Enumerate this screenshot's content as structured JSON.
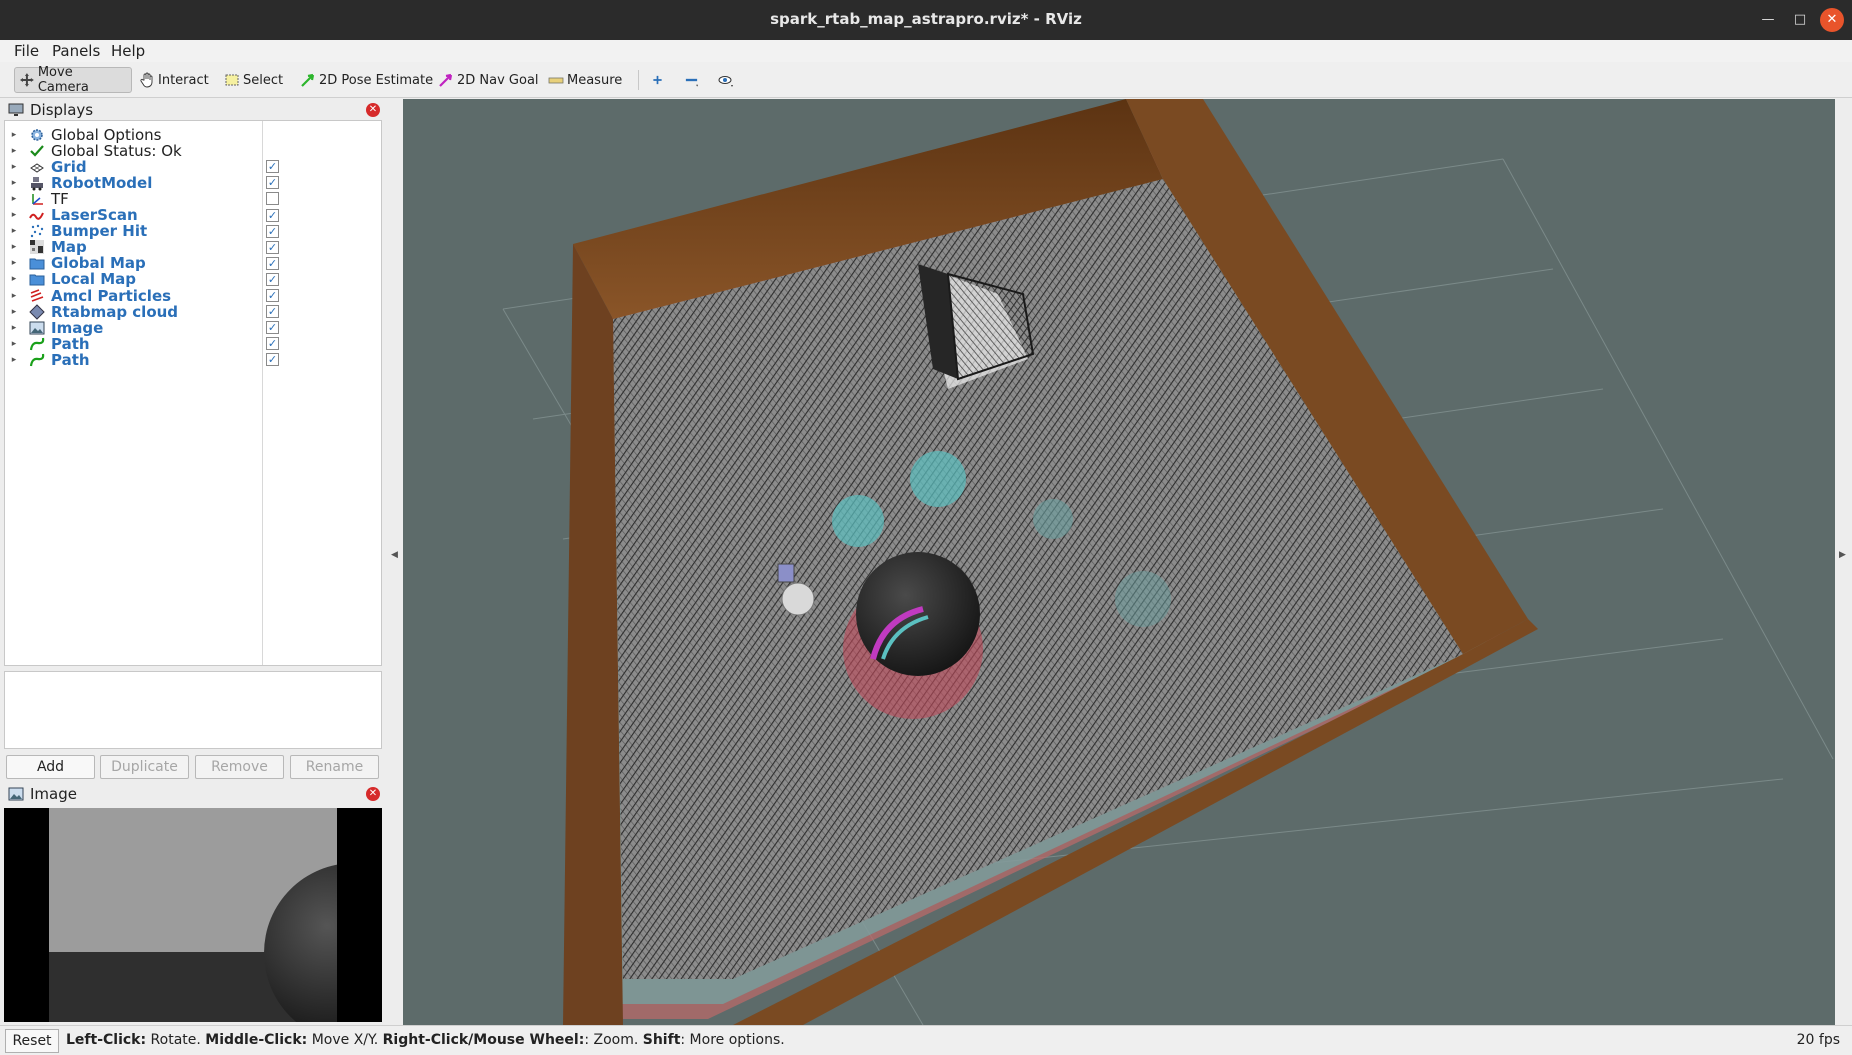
{
  "window": {
    "title": "spark_rtab_map_astrapro.rviz* - RViz"
  },
  "menu": {
    "file": "File",
    "panels": "Panels",
    "help": "Help"
  },
  "toolbar": {
    "move_camera": "Move Camera",
    "interact": "Interact",
    "select": "Select",
    "pose_estimate": "2D Pose Estimate",
    "nav_goal": "2D Nav Goal",
    "measure": "Measure"
  },
  "displays_panel": {
    "title": "Displays",
    "items": [
      {
        "label": "Global Options",
        "icon": "gear-icon",
        "bold": false,
        "checkbox": null
      },
      {
        "label": "Global Status: Ok",
        "icon": "check-icon",
        "bold": false,
        "checkbox": null
      },
      {
        "label": "Grid",
        "icon": "grid-icon",
        "bold": true,
        "checkbox": true
      },
      {
        "label": "RobotModel",
        "icon": "robot-icon",
        "bold": true,
        "checkbox": true
      },
      {
        "label": "TF",
        "icon": "axes-icon",
        "bold": false,
        "checkbox": false
      },
      {
        "label": "LaserScan",
        "icon": "laser-icon",
        "bold": true,
        "checkbox": true
      },
      {
        "label": "Bumper Hit",
        "icon": "points-icon",
        "bold": true,
        "checkbox": true
      },
      {
        "label": "Map",
        "icon": "map-icon",
        "bold": true,
        "checkbox": true
      },
      {
        "label": "Global Map",
        "icon": "folder-icon",
        "bold": true,
        "checkbox": true
      },
      {
        "label": "Local Map",
        "icon": "folder-icon",
        "bold": true,
        "checkbox": true
      },
      {
        "label": "Amcl Particles",
        "icon": "particles-icon",
        "bold": true,
        "checkbox": true
      },
      {
        "label": "Rtabmap cloud",
        "icon": "cloud-icon",
        "bold": true,
        "checkbox": true
      },
      {
        "label": "Image",
        "icon": "image-icon",
        "bold": true,
        "checkbox": true
      },
      {
        "label": "Path",
        "icon": "path-icon",
        "bold": true,
        "checkbox": true
      },
      {
        "label": "Path",
        "icon": "path-icon",
        "bold": true,
        "checkbox": true
      }
    ],
    "buttons": {
      "add": "Add",
      "duplicate": "Duplicate",
      "remove": "Remove",
      "rename": "Rename"
    }
  },
  "image_panel": {
    "title": "Image"
  },
  "status": {
    "reset": "Reset",
    "hint_left_key": "Left-Click:",
    "hint_left_val": " Rotate. ",
    "hint_mid_key": "Middle-Click:",
    "hint_mid_val": " Move X/Y. ",
    "hint_right_key": "Right-Click/Mouse Wheel:",
    "hint_right_val": ": Zoom. ",
    "hint_shift_key": "Shift",
    "hint_shift_val": ": More options.",
    "fps": "20 fps"
  },
  "colors": {
    "accent_label": "#2a6fb8",
    "viewport_bg": "#5d6b6a",
    "wall": "#7a4a22",
    "inflation_cyan": "#5ec8c8",
    "inflation_red": "#c85a5a"
  }
}
